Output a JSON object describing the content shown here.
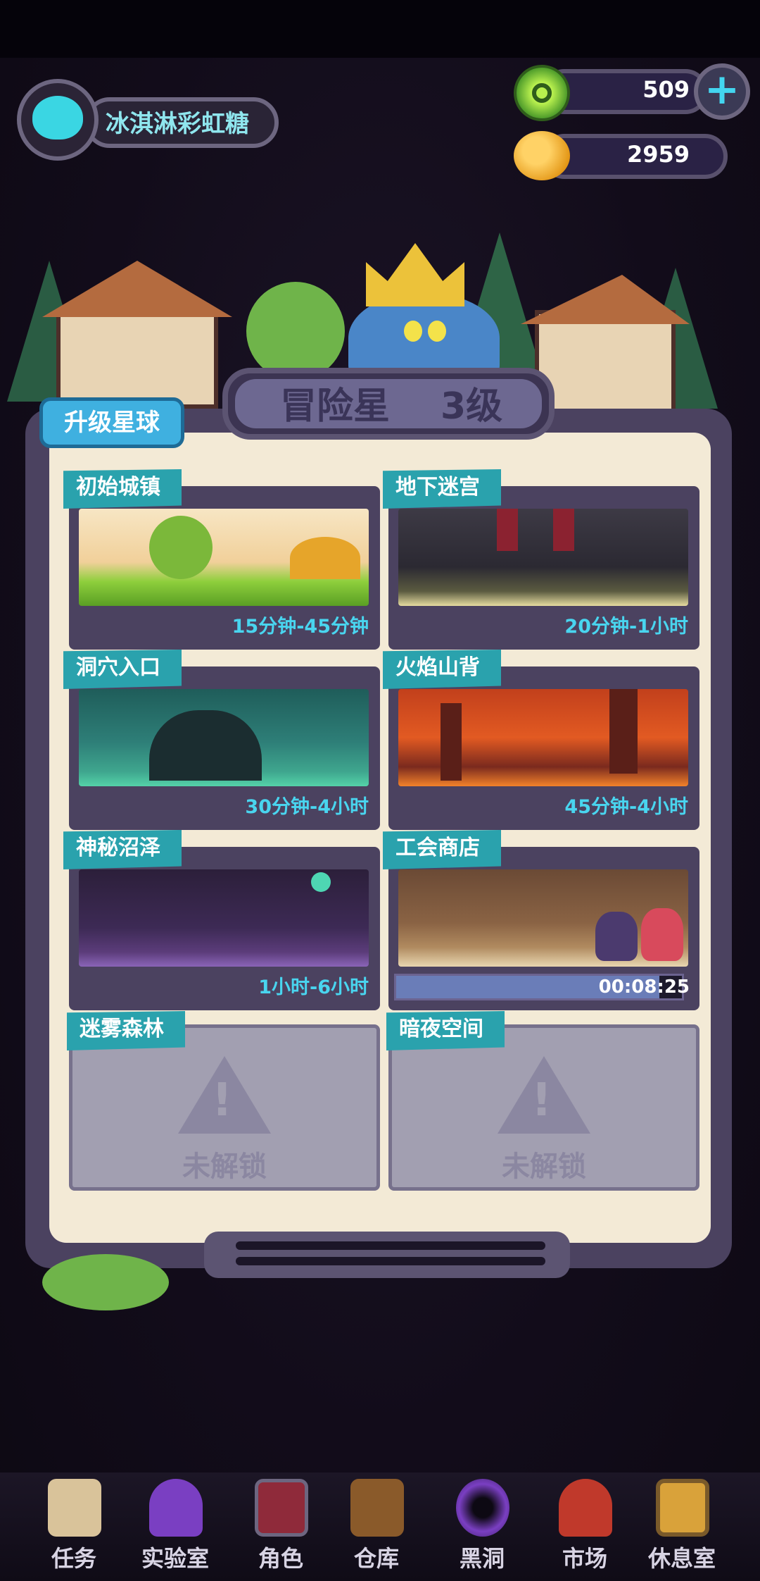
{
  "profile": {
    "name": "冰淇淋彩虹糖"
  },
  "currency": {
    "gems": "509",
    "coins": "2959",
    "add_symbol": "+"
  },
  "planet": {
    "title": "冒险星",
    "level": "3级",
    "upgrade_label": "升级星球"
  },
  "areas": [
    {
      "name": "初始城镇",
      "duration": "15分钟-45分钟",
      "locked": false
    },
    {
      "name": "地下迷宫",
      "duration": "20分钟-1小时",
      "locked": false
    },
    {
      "name": "洞穴入口",
      "duration": "30分钟-4小时",
      "locked": false
    },
    {
      "name": "火焰山背",
      "duration": "45分钟-4小时",
      "locked": false
    },
    {
      "name": "神秘沼泽",
      "duration": "1小时-6小时",
      "locked": false
    },
    {
      "name": "工会商店",
      "timer": "00:08:25",
      "progress": 0.92,
      "locked": false
    },
    {
      "name": "迷雾森林",
      "status": "未解锁",
      "locked": true
    },
    {
      "name": "暗夜空间",
      "status": "未解锁",
      "locked": true
    }
  ],
  "nav": [
    {
      "label": "任务",
      "icon": "quest-scroll-icon"
    },
    {
      "label": "实验室",
      "icon": "lab-jar-icon"
    },
    {
      "label": "角色",
      "icon": "character-portrait-icon"
    },
    {
      "label": "仓库",
      "icon": "storage-chest-icon"
    },
    {
      "label": "黑洞",
      "icon": "black-hole-icon"
    },
    {
      "label": "市场",
      "icon": "market-icon"
    },
    {
      "label": "休息室",
      "icon": "lounge-icon"
    }
  ],
  "colors": {
    "accent": "#2aa2ad",
    "time_text": "#49d5ef",
    "board": "#f3ead6",
    "frame": "#4b4260"
  }
}
